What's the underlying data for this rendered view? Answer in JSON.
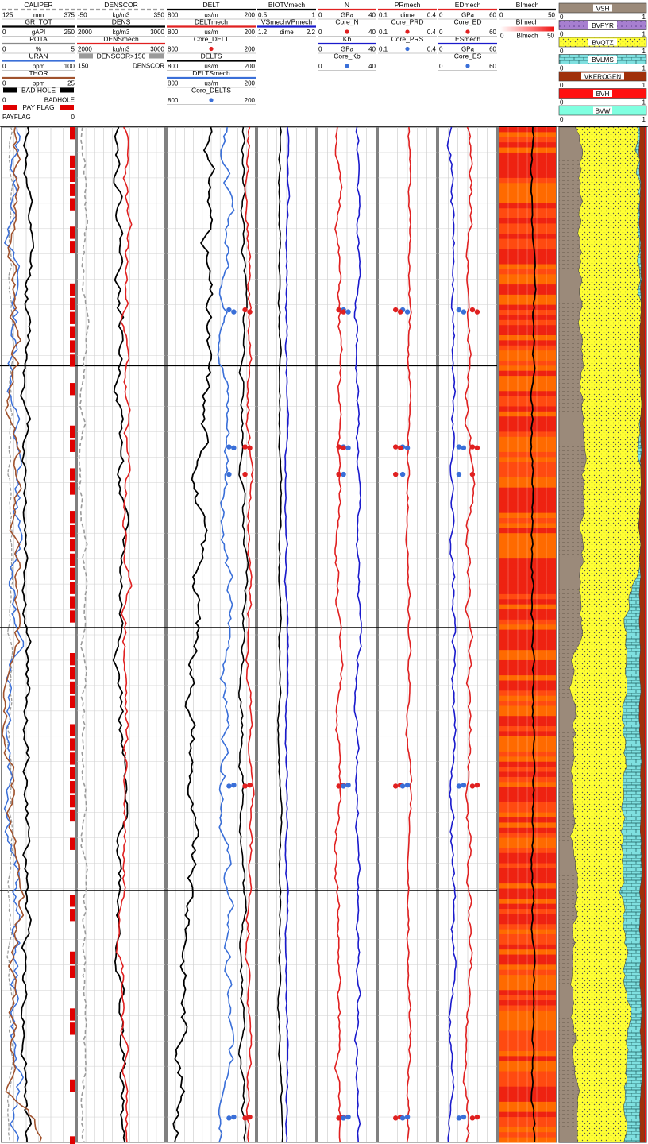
{
  "chart_data": {
    "type": "line",
    "tracks": [
      {
        "id": "gr",
        "headers": [
          {
            "name": "CALIPER",
            "color": "#9a9a9a",
            "dash": true,
            "left": "125",
            "unit": "mm",
            "right": "375"
          },
          {
            "name": "GR_TOT",
            "color": "#000000",
            "left": "0",
            "unit": "gAPI",
            "right": "250"
          },
          {
            "name": "POTA",
            "color": "#8a8a8a",
            "left": "0",
            "unit": "%",
            "right": "5"
          },
          {
            "name": "URAN",
            "color": "#3a6fd8",
            "left": "0",
            "unit": "ppm",
            "right": "100"
          },
          {
            "name": "THOR",
            "color": "#a0522d",
            "left": "0",
            "unit": "ppm",
            "right": "25"
          }
        ],
        "flags": [
          {
            "name": "BAD HOLE",
            "left": "0",
            "right": "BADHOLE",
            "color": "#000000"
          },
          {
            "name": "PAY FLAG",
            "left": "PAYFLAG",
            "right": "0",
            "color": "#e00000"
          }
        ]
      },
      {
        "id": "dens",
        "headers": [
          {
            "name": "DENSCOR",
            "color": "#9a9a9a",
            "dash": true,
            "left": "-50",
            "unit": "kg/m3",
            "right": "350"
          },
          {
            "name": "DENS",
            "color": "#000000",
            "left": "2000",
            "unit": "kg/m3",
            "right": "3000"
          },
          {
            "name": "DENSmech",
            "color": "#e02020",
            "left": "2000",
            "unit": "kg/m3",
            "right": "3000"
          }
        ],
        "flags": [
          {
            "name": "DENSCOR>150",
            "left": "150",
            "right": "DENSCOR",
            "color": "#9a9a9a"
          }
        ]
      },
      {
        "id": "delt",
        "headers": [
          {
            "name": "DELT",
            "color": "#000000",
            "left": "800",
            "unit": "us/m",
            "right": "200"
          },
          {
            "name": "DELTmech",
            "color": "#e02020",
            "left": "800",
            "unit": "us/m",
            "right": "200"
          },
          {
            "name": "Core_DELT",
            "color": "#e02020",
            "dot": true,
            "left": "800",
            "unit": "",
            "right": "200"
          },
          {
            "name": "DELTS",
            "color": "#000000",
            "left": "800",
            "unit": "us/m",
            "right": "200"
          },
          {
            "name": "DELTSmech",
            "color": "#3a6fd8",
            "left": "800",
            "unit": "us/m",
            "right": "200"
          },
          {
            "name": "Core_DELTS",
            "color": "#3a6fd8",
            "dot": true,
            "left": "800",
            "unit": "",
            "right": "200"
          }
        ]
      },
      {
        "id": "biot",
        "headers": [
          {
            "name": "BIOTVmech",
            "color": "#000000",
            "left": "0.5",
            "unit": "",
            "right": "1"
          },
          {
            "name": "VSmechVPmech",
            "color": "#1a1acc",
            "left": "1.2",
            "unit": "dime",
            "right": "2.2"
          }
        ]
      },
      {
        "id": "n",
        "headers": [
          {
            "name": "N",
            "color": "#e02020",
            "left": "0",
            "unit": "GPa",
            "right": "40"
          },
          {
            "name": "Core_N",
            "color": "#e02020",
            "dot": true,
            "left": "0",
            "unit": "",
            "right": "40"
          },
          {
            "name": "Kb",
            "color": "#1a1acc",
            "left": "0",
            "unit": "GPa",
            "right": "40"
          },
          {
            "name": "Core_Kb",
            "color": "#3a6fd8",
            "dot": true,
            "left": "0",
            "unit": "",
            "right": "40"
          }
        ]
      },
      {
        "id": "pr",
        "headers": [
          {
            "name": "PRmech",
            "color": "#e02020",
            "left": "0.1",
            "unit": "dime",
            "right": "0.4"
          },
          {
            "name": "Core_PRD",
            "color": "#e02020",
            "dot": true,
            "left": "0.1",
            "unit": "",
            "right": "0.4"
          },
          {
            "name": "Core_PRS",
            "color": "#3a6fd8",
            "dot": true,
            "left": "0.1",
            "unit": "",
            "right": "0.4"
          }
        ]
      },
      {
        "id": "ed",
        "headers": [
          {
            "name": "EDmech",
            "color": "#e02020",
            "left": "0",
            "unit": "GPa",
            "right": "60"
          },
          {
            "name": "Core_ED",
            "color": "#e02020",
            "dot": true,
            "left": "0",
            "unit": "",
            "right": "60"
          },
          {
            "name": "ESmech",
            "color": "#1a1acc",
            "left": "0",
            "unit": "GPa",
            "right": "60"
          },
          {
            "name": "Core_ES",
            "color": "#3a6fd8",
            "dot": true,
            "left": "0",
            "unit": "",
            "right": "60"
          }
        ]
      },
      {
        "id": "bi",
        "headers": [
          {
            "name": "BImech",
            "color": "#000000",
            "left": "0",
            "unit": "",
            "right": "50"
          },
          {
            "name": "BImech",
            "color": "#e02020",
            "gradient": true,
            "left": "0",
            "unit": "BImech",
            "right": "50"
          }
        ]
      },
      {
        "id": "lith",
        "headers": [
          {
            "name": "VSH",
            "fill": "#9b8a7a",
            "left": "0",
            "right": "1"
          },
          {
            "name": "BVPYR",
            "fill": "#a77fd0",
            "left": "0",
            "right": "1"
          },
          {
            "name": "BVQTZ",
            "fill": "#ffff33",
            "left": "0",
            "right": "1"
          },
          {
            "name": "BVLMS",
            "fill": "#7fe0e0",
            "left": "0",
            "right": "1"
          },
          {
            "name": "VKEROGEN",
            "fill": "#a0300a",
            "left": "0",
            "right": "1"
          },
          {
            "name": "BVH",
            "fill": "#ff1010",
            "left": "0",
            "right": "1"
          },
          {
            "name": "BVW",
            "fill": "#80ffe0",
            "left": "0",
            "right": "1"
          }
        ]
      }
    ],
    "depth_range": [
      0,
      100
    ],
    "grid": true,
    "core_depths": [
      18,
      18.2,
      31.5,
      31.6,
      34.2,
      64.8,
      64.9,
      97.5,
      97.6
    ],
    "colors": {
      "bad_hole": "#000000",
      "pay_flag": "#e00000",
      "shale": "#9b8a7a",
      "quartz": "#ffff33",
      "limestone": "#7fe0e0",
      "kerogen": "#a0300a",
      "hydrocarbon": "#ff1010",
      "bi_low": "#ff6a00",
      "bi_high": "#ee1111"
    }
  }
}
